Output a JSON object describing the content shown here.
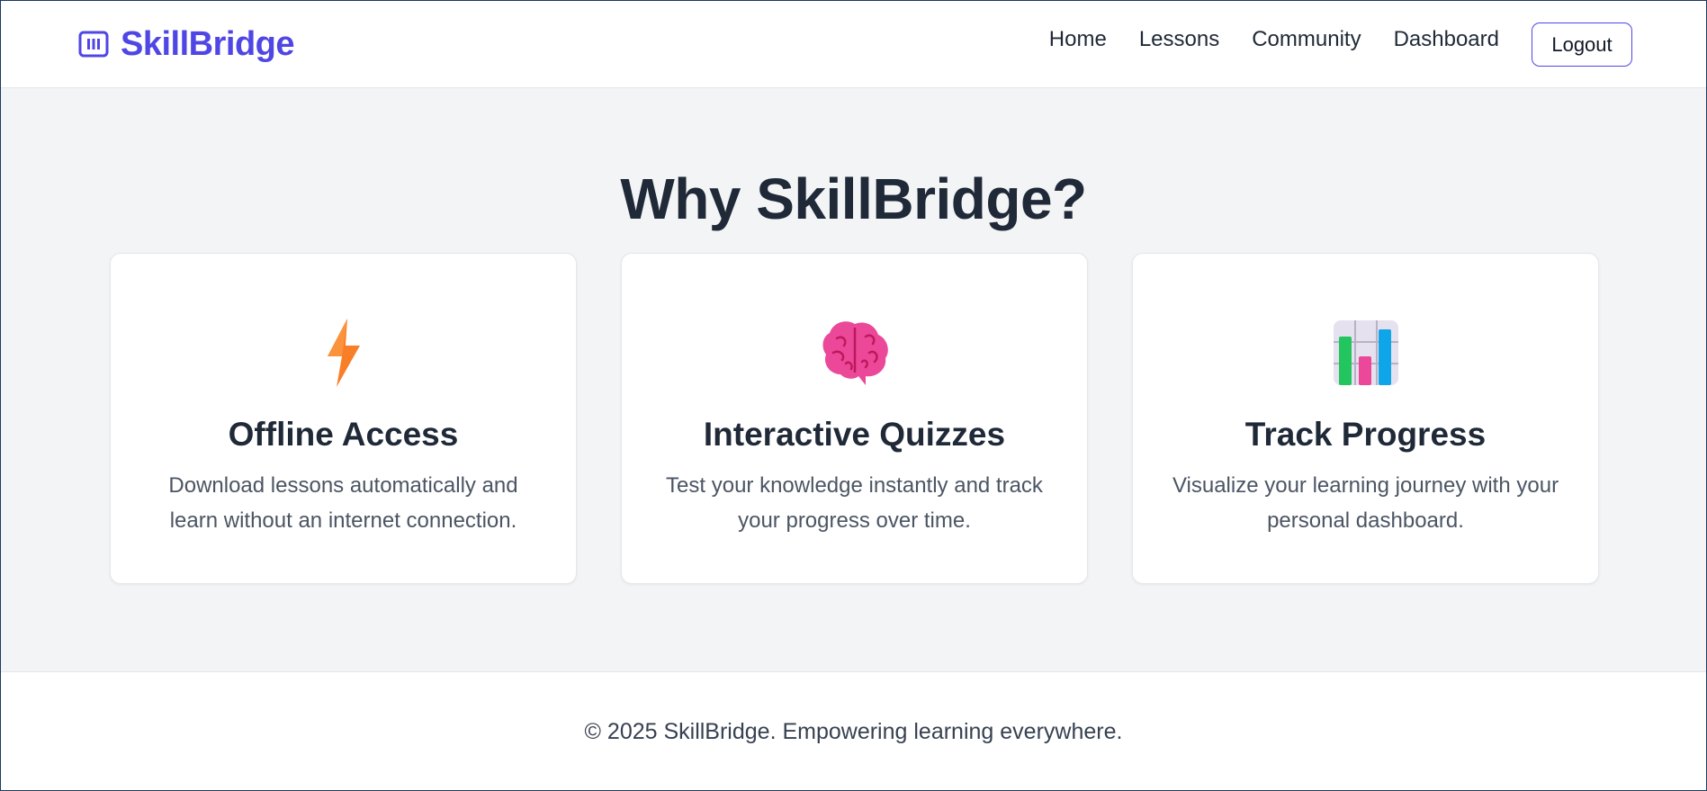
{
  "header": {
    "brand_name": "SkillBridge",
    "brand_icon": "building-columns-icon",
    "nav": [
      {
        "label": "Home"
      },
      {
        "label": "Lessons"
      },
      {
        "label": "Community"
      },
      {
        "label": "Dashboard"
      }
    ],
    "logout_label": "Logout"
  },
  "features": {
    "title": "Why SkillBridge?",
    "cards": [
      {
        "icon": "lightning-bolt-icon",
        "title": "Offline Access",
        "description": "Download lessons automatically and learn without an internet connection."
      },
      {
        "icon": "brain-icon",
        "title": "Interactive Quizzes",
        "description": "Test your knowledge instantly and track your progress over time."
      },
      {
        "icon": "bar-chart-icon",
        "title": "Track Progress",
        "description": "Visualize your learning journey with your personal dashboard."
      }
    ]
  },
  "footer": {
    "text": "© 2025 SkillBridge. Empowering learning everywhere."
  },
  "colors": {
    "brand": "#4f46e5",
    "background": "#f3f4f6",
    "text": "#1f2937"
  }
}
